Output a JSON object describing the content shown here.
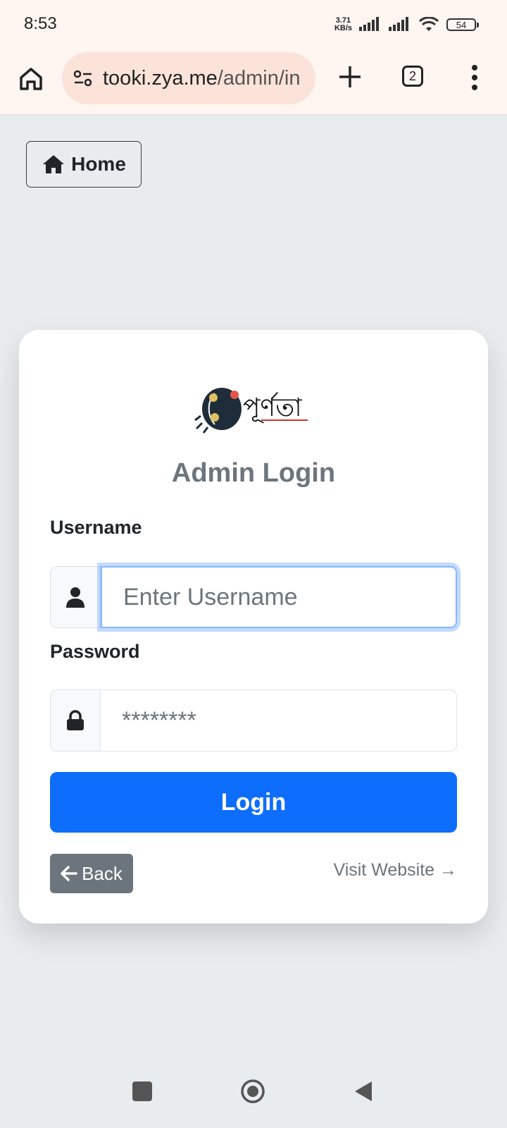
{
  "status_bar": {
    "time": "8:53",
    "net_speed_value": "3.71",
    "net_speed_unit": "KB/s",
    "battery": "54"
  },
  "browser": {
    "url_host": "tooki.zya.me",
    "url_path": "/admin/in",
    "tab_count": "2"
  },
  "page": {
    "home_label": "Home",
    "title": "Admin Login",
    "username_label": "Username",
    "username_placeholder": "Enter Username",
    "password_label": "Password",
    "password_placeholder": "********",
    "login_label": "Login",
    "back_label": "Back",
    "visit_label": "Visit Website →",
    "logo_text": "পূর্ণতা"
  },
  "colors": {
    "primary": "#0d6efd",
    "secondary": "#6c757d",
    "page_bg": "#e9ecef",
    "browser_bg": "#fff5f1"
  }
}
